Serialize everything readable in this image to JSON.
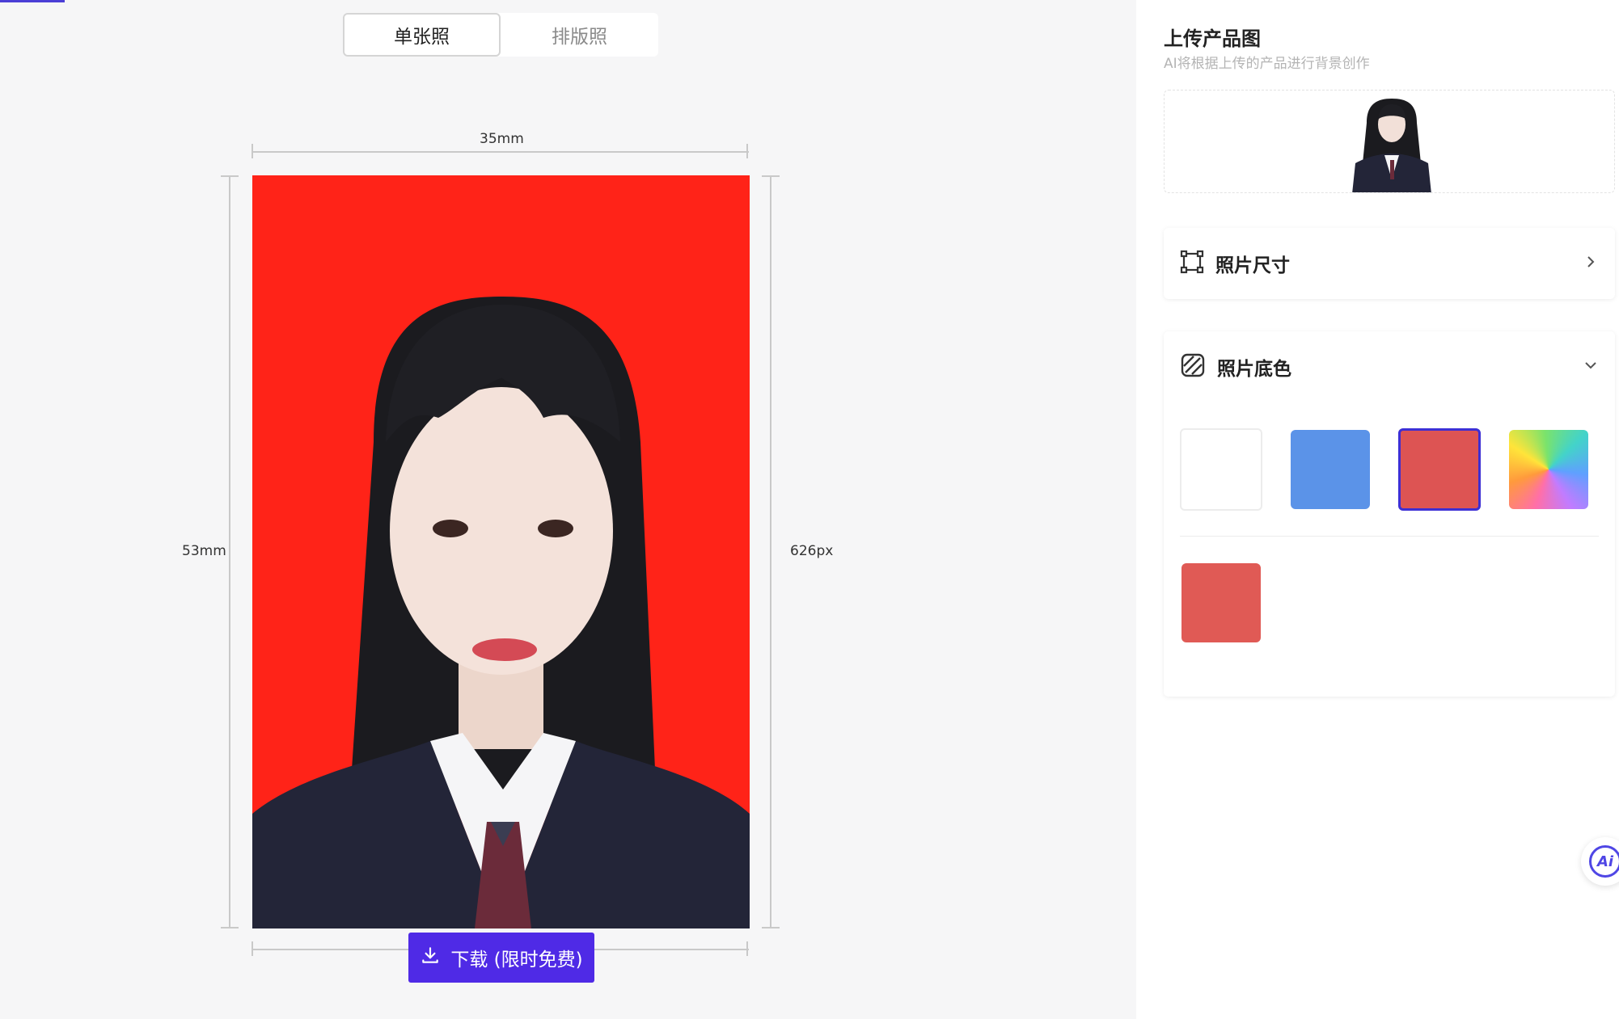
{
  "tabs": [
    {
      "label": "单张照",
      "active": true
    },
    {
      "label": "排版照",
      "active": false
    }
  ],
  "dimensions": {
    "width_label": "35mm",
    "height_label": "53mm",
    "px_label": "626px"
  },
  "photo": {
    "background_color": "#ff2318",
    "subject": "portrait of woman in school uniform"
  },
  "download": {
    "icon": "download-icon",
    "label": "下载 (限时免费)",
    "color": "#4f2ae6"
  },
  "panel": {
    "title": "上传产品图",
    "subtitle": "AI将根据上传的产品进行背景创作",
    "size_card": {
      "icon": "crop-frame-icon",
      "title": "照片尺寸",
      "chevron": "chevron-right-icon"
    },
    "color_card": {
      "icon": "hatched-square-icon",
      "title": "照片底色",
      "chevron": "chevron-down-icon",
      "swatches": [
        {
          "name": "white",
          "color": "#ffffff",
          "selected": false
        },
        {
          "name": "blue",
          "color": "#5b93e8",
          "selected": false
        },
        {
          "name": "red",
          "color": "#dd5453",
          "selected": true
        },
        {
          "name": "rainbow",
          "color": "gradient",
          "selected": false
        }
      ],
      "custom_swatch": {
        "color": "#e05a55"
      }
    }
  },
  "accent_color": "#4b3fd6",
  "ai_button": {
    "label": "Ai"
  }
}
